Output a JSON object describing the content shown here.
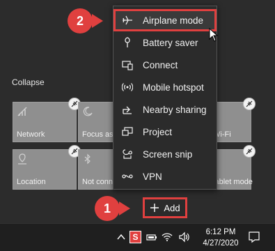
{
  "panel": {
    "collapse_label": "Collapse",
    "tiles": [
      {
        "label": "Network",
        "icon": "network-icon"
      },
      {
        "label": "Focus assist",
        "icon": "moon-icon"
      },
      {
        "label": "Wi-Fi",
        "icon": "wifi-icon"
      },
      {
        "label": "Location",
        "icon": "location-icon"
      },
      {
        "label": "Not connected",
        "icon": "bluetooth-icon"
      },
      {
        "label": "Tablet mode",
        "icon": "tablet-icon"
      }
    ],
    "add_label": "Add"
  },
  "menu": {
    "items": [
      {
        "label": "Airplane mode",
        "icon": "airplane-icon",
        "highlighted": true
      },
      {
        "label": "Battery saver",
        "icon": "battery-saver-icon"
      },
      {
        "label": "Connect",
        "icon": "connect-icon"
      },
      {
        "label": "Mobile hotspot",
        "icon": "hotspot-icon"
      },
      {
        "label": "Nearby sharing",
        "icon": "share-icon"
      },
      {
        "label": "Project",
        "icon": "project-icon"
      },
      {
        "label": "Screen snip",
        "icon": "snip-icon"
      },
      {
        "label": "VPN",
        "icon": "vpn-icon"
      }
    ]
  },
  "callouts": {
    "step1": "1",
    "step2": "2",
    "color": "#e0403f"
  },
  "taskbar": {
    "time": "6:12 PM",
    "date": "4/27/2020"
  }
}
